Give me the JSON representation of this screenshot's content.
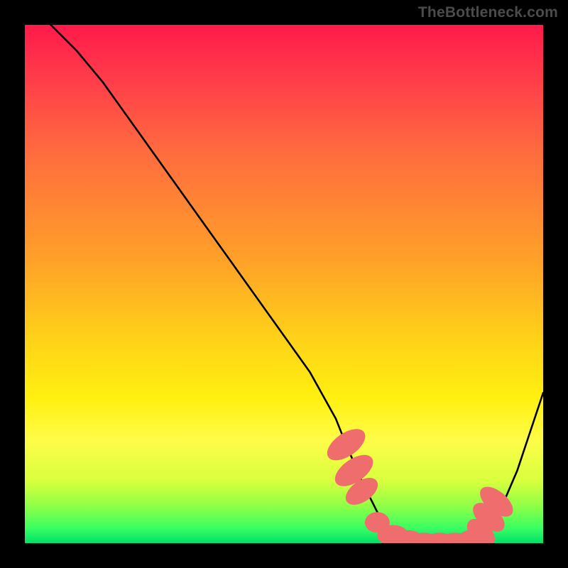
{
  "watermark": "TheBottleneck.com",
  "chart_data": {
    "type": "line",
    "title": "",
    "xlabel": "",
    "ylabel": "",
    "xlim": [
      0,
      100
    ],
    "ylim": [
      0,
      100
    ],
    "series": [
      {
        "name": "bottleneck-curve",
        "x": [
          5,
          10,
          15,
          20,
          25,
          30,
          35,
          40,
          45,
          50,
          55,
          60,
          62,
          65,
          68,
          70,
          73,
          76,
          79,
          82,
          84,
          86,
          88,
          90,
          92,
          95,
          100
        ],
        "y": [
          100,
          95,
          89,
          82,
          75,
          68,
          61,
          54,
          47,
          40,
          33,
          24,
          19,
          12,
          6,
          3,
          1,
          0,
          0,
          0,
          0,
          0,
          1,
          3,
          7,
          14,
          29
        ]
      }
    ],
    "markers": {
      "name": "optimal-range",
      "color": "#ef6d6d",
      "points": [
        {
          "x": 62,
          "y": 19,
          "rx": 2.2,
          "ry": 4.2,
          "rot": 55
        },
        {
          "x": 63.5,
          "y": 14,
          "rx": 2.2,
          "ry": 4.2,
          "rot": 55
        },
        {
          "x": 65,
          "y": 10,
          "rx": 2.0,
          "ry": 3.5,
          "rot": 55
        },
        {
          "x": 68,
          "y": 4,
          "rx": 2.4,
          "ry": 2.0,
          "rot": 0
        },
        {
          "x": 71,
          "y": 1.5,
          "rx": 3.0,
          "ry": 2.0,
          "rot": 0
        },
        {
          "x": 74,
          "y": 0.5,
          "rx": 3.0,
          "ry": 2.0,
          "rot": 0
        },
        {
          "x": 77,
          "y": 0,
          "rx": 3.0,
          "ry": 2.0,
          "rot": 0
        },
        {
          "x": 80,
          "y": 0,
          "rx": 3.0,
          "ry": 2.0,
          "rot": 0
        },
        {
          "x": 83,
          "y": 0,
          "rx": 3.0,
          "ry": 2.0,
          "rot": 0
        },
        {
          "x": 86,
          "y": 0.5,
          "rx": 2.6,
          "ry": 2.0,
          "rot": 0
        },
        {
          "x": 88,
          "y": 2,
          "rx": 2.0,
          "ry": 3.2,
          "rot": -45
        },
        {
          "x": 89.5,
          "y": 5,
          "rx": 2.0,
          "ry": 3.6,
          "rot": -50
        },
        {
          "x": 91,
          "y": 8,
          "rx": 2.0,
          "ry": 3.8,
          "rot": -50
        }
      ]
    }
  }
}
